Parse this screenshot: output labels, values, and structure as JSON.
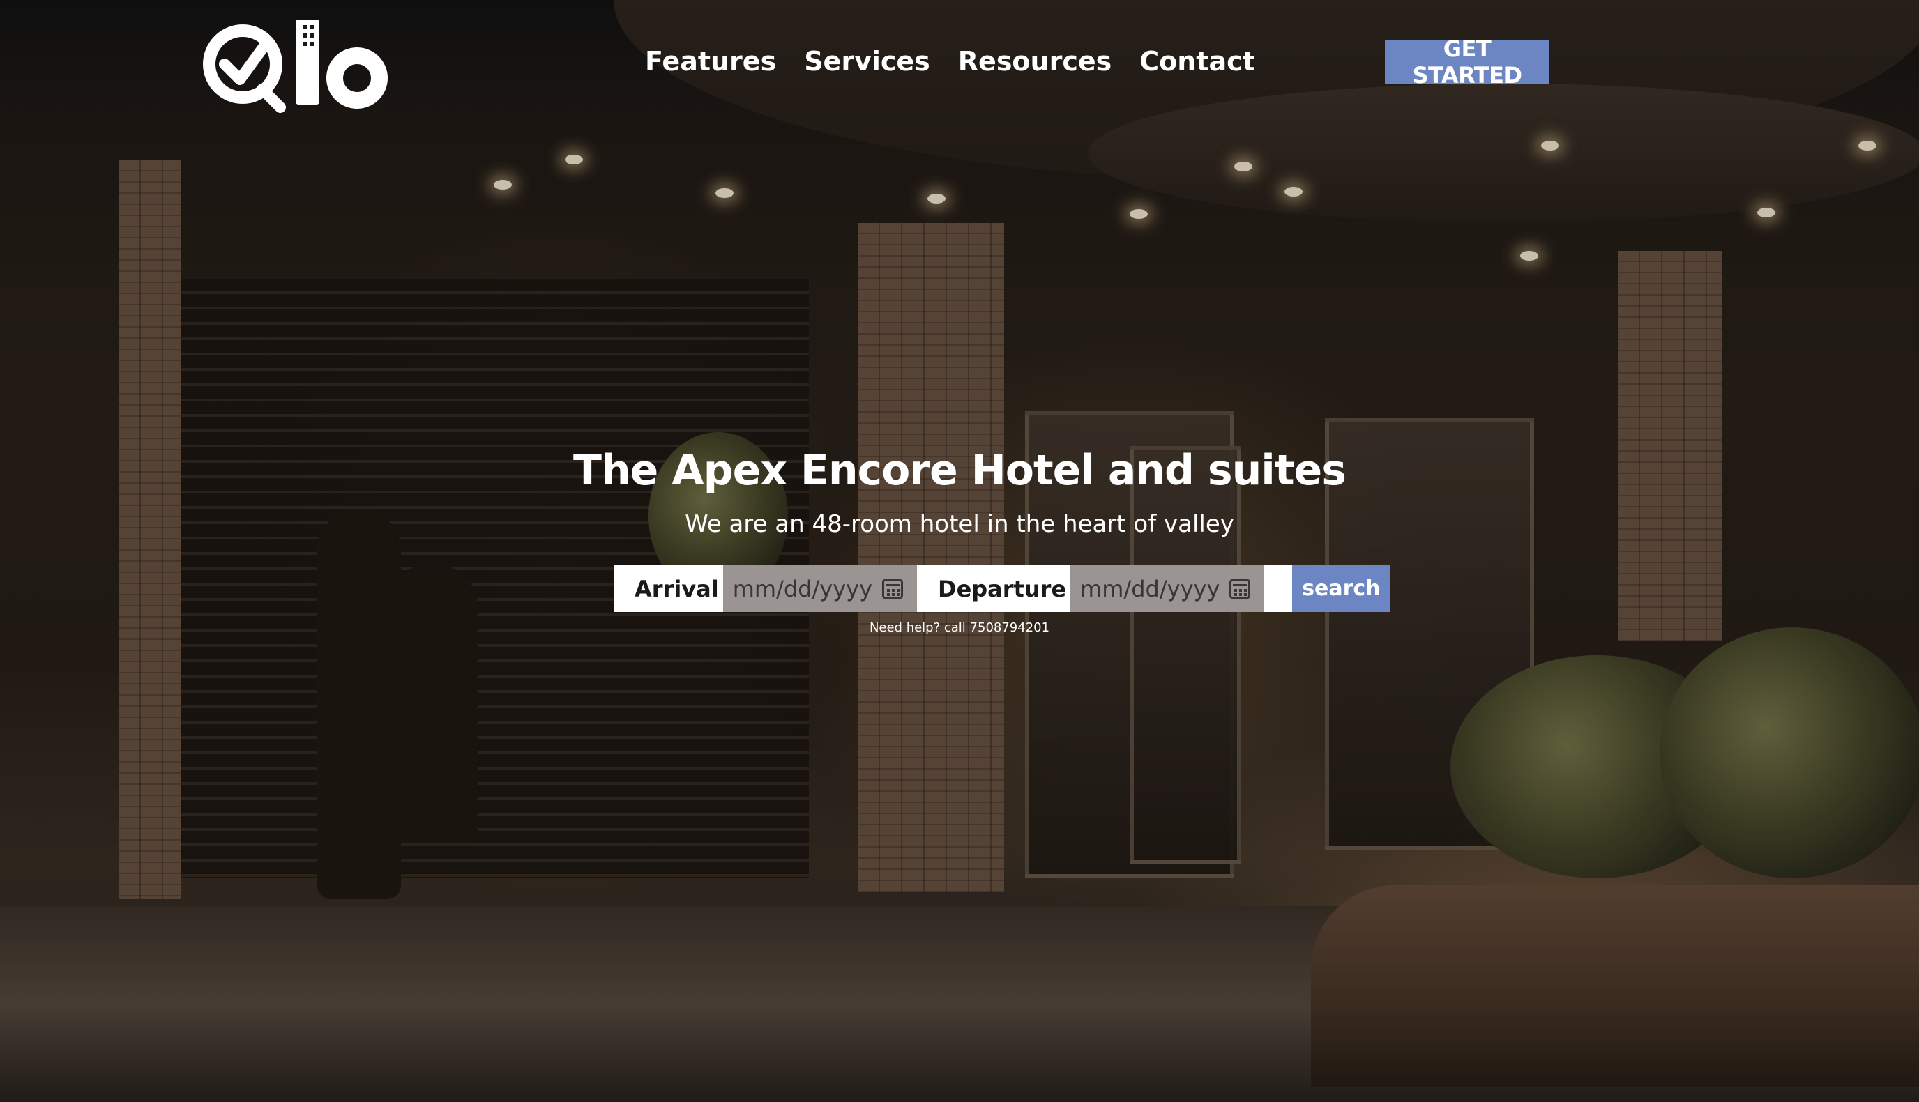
{
  "brand": {
    "logo_text": "Qlo",
    "logo_icon": "checkmark-magnifier-icon"
  },
  "nav": {
    "items": [
      {
        "label": "Features"
      },
      {
        "label": "Services"
      },
      {
        "label": "Resources"
      },
      {
        "label": "Contact"
      }
    ],
    "cta_label": "GET STARTED"
  },
  "hero": {
    "title": "The Apex Encore Hotel and suites",
    "subtitle": "We are an 48-room hotel in the heart of valley"
  },
  "booking": {
    "arrival_label": "Arrival",
    "arrival_placeholder": "mm/dd/yyyy",
    "departure_label": "Departure",
    "departure_placeholder": "mm/dd/yyyy",
    "search_label": "search",
    "help_text": "Need help? call 7508794201"
  },
  "colors": {
    "accent": "#6b86c2",
    "date_field_bg": "#9a9593",
    "text_on_dark": "#ffffff"
  }
}
